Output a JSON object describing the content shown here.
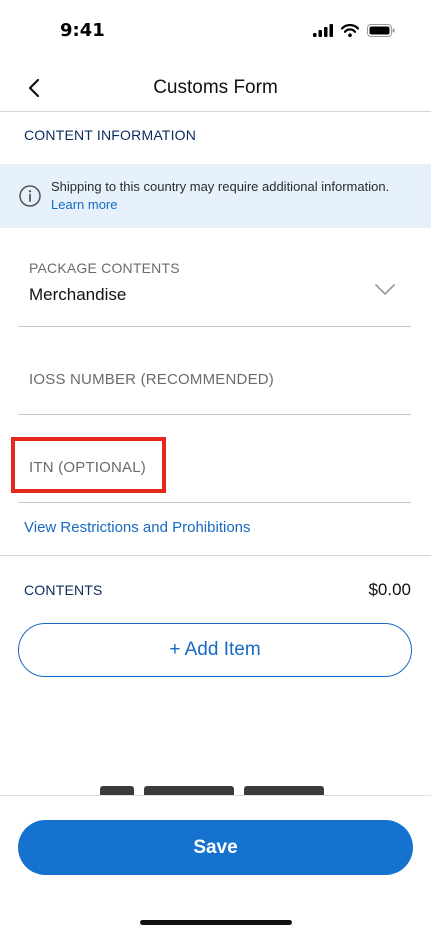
{
  "status_bar": {
    "time": "9:41"
  },
  "header": {
    "title": "Customs Form"
  },
  "content_section": {
    "label": "CONTENT INFORMATION"
  },
  "info_banner": {
    "message": "Shipping to this country may require additional information.",
    "link": "Learn more"
  },
  "fields": {
    "package_contents": {
      "label": "PACKAGE CONTENTS",
      "value": "Merchandise"
    },
    "ioss_number": {
      "placeholder": "IOSS NUMBER (RECOMMENDED)"
    },
    "itn": {
      "placeholder": "ITN (OPTIONAL)"
    }
  },
  "restrictions_link": "View Restrictions and Prohibitions",
  "contents": {
    "label": "CONTENTS",
    "total": "$0.00"
  },
  "add_item_button": "+ Add Item",
  "save_button": "Save",
  "colors": {
    "accent": "#1769c4",
    "primary_button": "#1572cf",
    "banner_bg": "#e6f1fb",
    "highlight": "#e4281c"
  }
}
